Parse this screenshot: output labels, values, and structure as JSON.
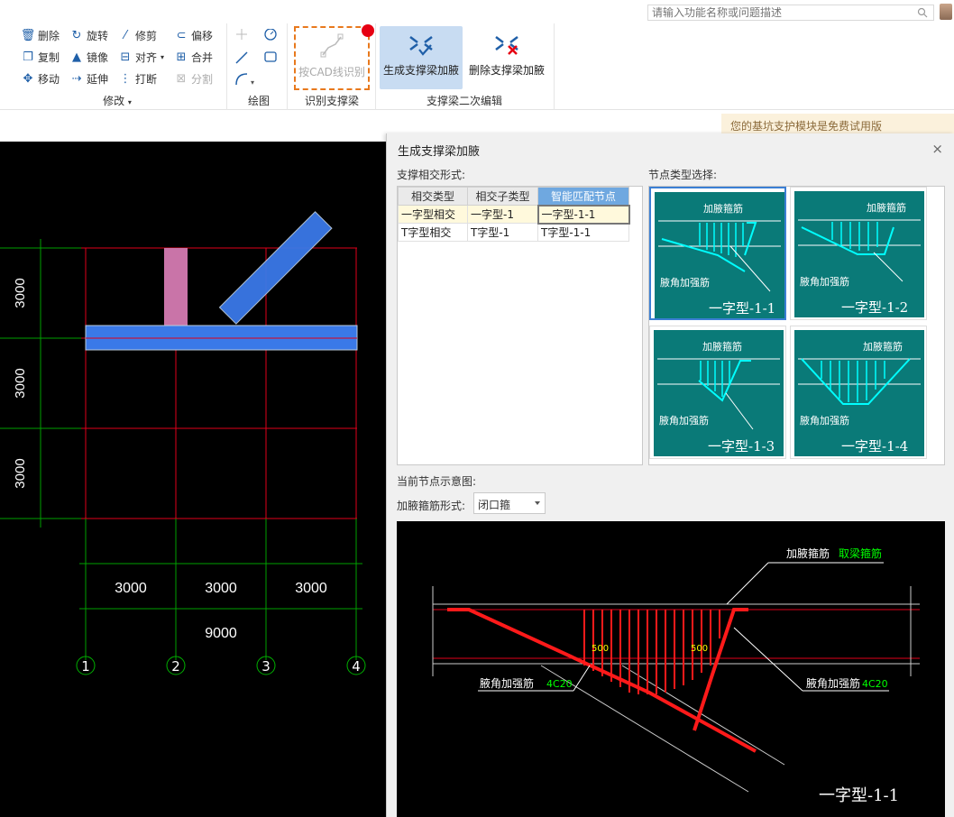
{
  "search": {
    "placeholder": "请输入功能名称或问题描述",
    "icon": "search-icon"
  },
  "ribbon": {
    "modify": {
      "label": "修改",
      "tools": [
        {
          "label": "删除",
          "icon": "delete-icon"
        },
        {
          "label": "旋转",
          "icon": "rotate-icon"
        },
        {
          "label": "修剪",
          "icon": "trim-icon"
        },
        {
          "label": "偏移",
          "icon": "offset-icon"
        },
        {
          "label": "复制",
          "icon": "copy-icon"
        },
        {
          "label": "镜像",
          "icon": "mirror-icon"
        },
        {
          "label": "对齐",
          "icon": "align-icon"
        },
        {
          "label": "合并",
          "icon": "merge-icon"
        },
        {
          "label": "移动",
          "icon": "move-icon"
        },
        {
          "label": "延伸",
          "icon": "extend-icon"
        },
        {
          "label": "打断",
          "icon": "break-icon"
        },
        {
          "label": "分割",
          "icon": "split-icon"
        }
      ]
    },
    "draw": {
      "label": "绘图"
    },
    "identify": {
      "label": "识别支撑梁",
      "button": "按CAD线识别"
    },
    "edit": {
      "label": "支撑梁二次编辑",
      "generate": "生成支撑梁加腋",
      "remove": "删除支撑梁加腋"
    }
  },
  "notice": "您的基坑支护模块是免费试用版",
  "canvas": {
    "dims_vertical": [
      "3000",
      "3000",
      "3000"
    ],
    "dims_horizontal": [
      "3000",
      "3000",
      "3000"
    ],
    "total": "9000",
    "axes": [
      "1",
      "2",
      "3",
      "4"
    ]
  },
  "dialog": {
    "title": "生成支撑梁加腋",
    "close": "×",
    "section_intersect": "支撑相交形式:",
    "section_node": "节点类型选择:",
    "section_current": "当前节点示意图:",
    "rebar_form_label": "加腋箍筋形式:",
    "rebar_form_value": "闭口箍",
    "table": {
      "headers": [
        "相交类型",
        "相交子类型",
        "智能匹配节点"
      ],
      "rows": [
        [
          "一字型相交",
          "一字型-1",
          "一字型-1-1"
        ],
        [
          "T字型相交",
          "T字型-1",
          "T字型-1-1"
        ]
      ]
    },
    "nodes": [
      {
        "title": "一字型-1-1",
        "top": "加腋箍筋",
        "bottom": "腋角加强筋"
      },
      {
        "title": "一字型-1-2",
        "top": "加腋箍筋",
        "bottom": "腋角加强筋"
      },
      {
        "title": "一字型-1-3",
        "top": "加腋箍筋",
        "bottom": "腋角加强筋"
      },
      {
        "title": "一字型-1-4",
        "top": "加腋箍筋",
        "bottom": "腋角加强筋"
      }
    ],
    "preview": {
      "label_top": "加腋箍筋",
      "label_top_sub": "取梁箍筋",
      "label_left": "腋角加强筋",
      "label_left_sub": "4C20",
      "label_right": "腋角加强筋",
      "label_right_sub": "4C20",
      "dim": "500",
      "title": "一字型-1-1"
    }
  }
}
